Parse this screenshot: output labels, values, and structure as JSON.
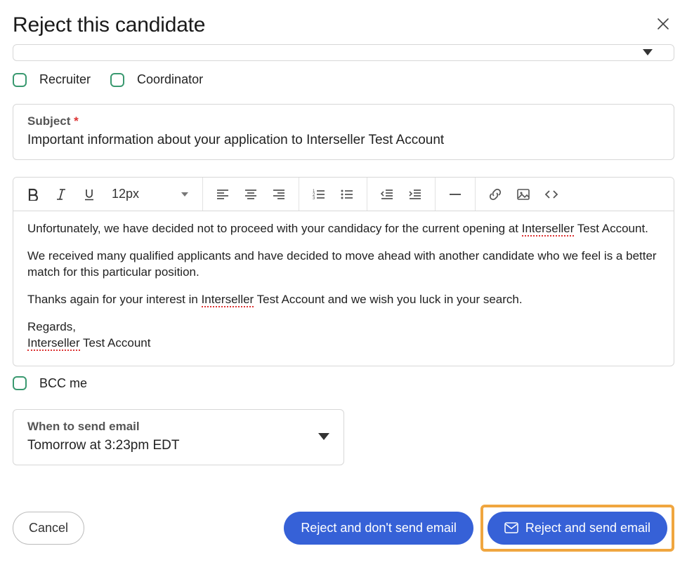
{
  "header": {
    "title": "Reject this candidate"
  },
  "checkboxes": {
    "recruiter": "Recruiter",
    "coordinator": "Coordinator",
    "bcc": "BCC me"
  },
  "subject": {
    "label": "Subject",
    "value": "Important information about your application to Interseller Test Account"
  },
  "toolbar": {
    "font_size": "12px"
  },
  "body": {
    "p1a": "Unfortunately, we have decided not to proceed with your candidacy for the current opening at ",
    "p1_mark": "Interseller",
    "p1b": " Test Account.",
    "p2": "We received many qualified applicants and have decided to move ahead with another candidate who we feel is a better match for this particular position.",
    "p3a": "Thanks again for your interest in ",
    "p3_mark": "Interseller",
    "p3b": " Test Account and we wish you luck in your search.",
    "p4a": "Regards,",
    "p4_mark": "Interseller",
    "p4b": " Test Account"
  },
  "schedule": {
    "label": "When to send email",
    "value": "Tomorrow at 3:23pm EDT"
  },
  "footer": {
    "cancel": "Cancel",
    "reject_no_email": "Reject and don't send email",
    "reject_send": "Reject and send email"
  }
}
